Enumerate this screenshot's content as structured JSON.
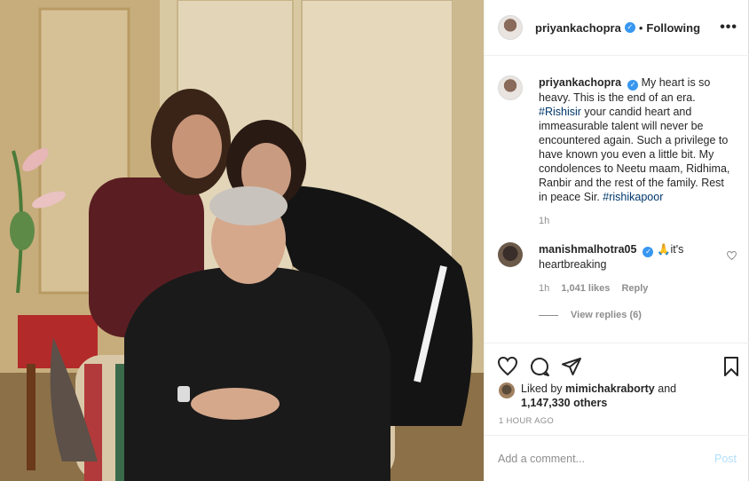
{
  "header": {
    "username": "priyankachopra",
    "verified_icon": "verified-badge-icon",
    "separator": "•",
    "follow_status": "Following",
    "more_icon": "more-options-icon"
  },
  "caption": {
    "username": "priyankachopra",
    "text_1": "My heart is so heavy. This is the end of an era. ",
    "tag_1": "#Rishisir",
    "text_2": " your candid heart and immeasurable talent will never be encountered again. Such a privilege to have known you even a little bit. My condolences to Neetu maam, Ridhima, Ranbir and the rest of the family. Rest in peace Sir. ",
    "tag_2": "#rishikapoor",
    "time": "1h"
  },
  "comment": {
    "username": "manishmalhotra05",
    "emoji": "🙏",
    "text": "it's heartbreaking",
    "time": "1h",
    "likes": "1,041 likes",
    "reply": "Reply",
    "view_replies": "View replies (6)"
  },
  "likes": {
    "prefix": "Liked by ",
    "user": "mimichakraborty",
    "and": " and",
    "count": "1,147,330 others"
  },
  "timestamp": "1 HOUR AGO",
  "add_comment": {
    "placeholder": "Add a comment...",
    "post_label": "Post"
  },
  "colors": {
    "link": "#00376b",
    "verified": "#3897f0",
    "muted": "#8e8e8e",
    "post_disabled": "#b2dffc"
  }
}
